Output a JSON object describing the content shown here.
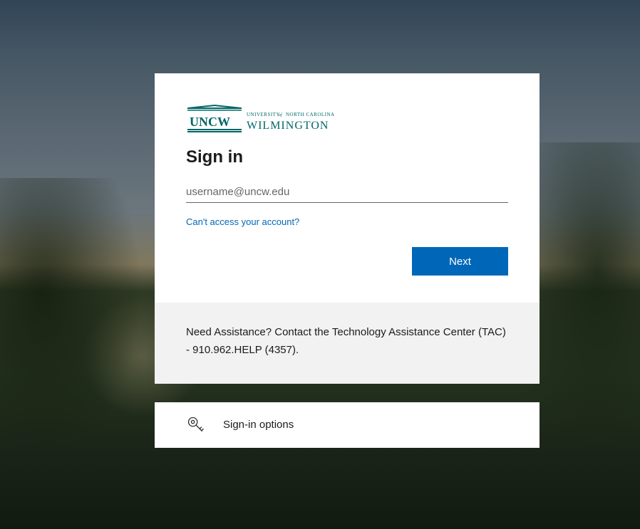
{
  "logo": {
    "acronym": "UNCW",
    "university": "UNIVERSITY of NORTH CAROLINA",
    "location": "WILMINGTON"
  },
  "signin": {
    "title": "Sign in",
    "placeholder": "username@uncw.edu",
    "cant_access_label": "Can't access your account?",
    "next_label": "Next"
  },
  "assistance": {
    "text": "Need Assistance? Contact the Technology Assistance Center (TAC) - 910.962.HELP (4357)."
  },
  "options": {
    "label": "Sign-in options"
  },
  "colors": {
    "primary_button": "#0067b8",
    "link": "#0067b8",
    "logo_teal": "#006666"
  }
}
